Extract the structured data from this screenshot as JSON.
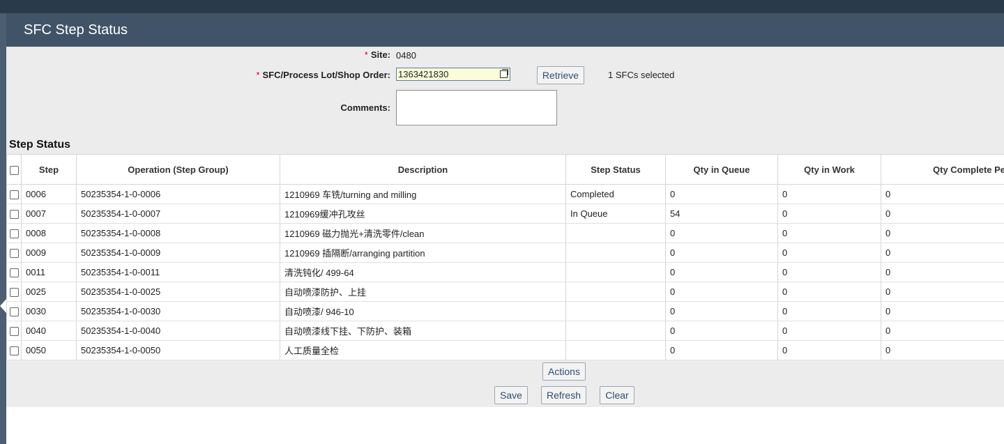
{
  "app": {
    "title": "SFC Step Status"
  },
  "form": {
    "site_label": "Site:",
    "site_value": "0480",
    "sfc_label": "SFC/Process Lot/Shop Order:",
    "sfc_value": "1363421830",
    "retrieve_label": "Retrieve",
    "selected_text": "1 SFCs selected",
    "comments_label": "Comments:",
    "required_mark": "*"
  },
  "step_status": {
    "title": "Step Status",
    "columns": [
      "Step",
      "Operation (Step Group)",
      "Description",
      "Step Status",
      "Qty in Queue",
      "Qty in Work",
      "Qty Complete Pe"
    ],
    "rows": [
      [
        "0006",
        "50235354-1-0-0006",
        "1210969 车铣/turning and milling",
        "Completed",
        "0",
        "0",
        "0"
      ],
      [
        "0007",
        "50235354-1-0-0007",
        "1210969缓冲孔攻丝",
        "In Queue",
        "54",
        "0",
        "0"
      ],
      [
        "0008",
        "50235354-1-0-0008",
        "1210969 磁力抛光+清洗零件/clean",
        "",
        "0",
        "0",
        "0"
      ],
      [
        "0009",
        "50235354-1-0-0009",
        "1210969 插隔断/arranging partition",
        "",
        "0",
        "0",
        "0"
      ],
      [
        "0011",
        "50235354-1-0-0011",
        "清洗钝化/ 499-64",
        "",
        "0",
        "0",
        "0"
      ],
      [
        "0025",
        "50235354-1-0-0025",
        "自动喷漆防护、上挂",
        "",
        "0",
        "0",
        "0"
      ],
      [
        "0030",
        "50235354-1-0-0030",
        "自动喷漆/ 946-10",
        "",
        "0",
        "0",
        "0"
      ],
      [
        "0040",
        "50235354-1-0-0040",
        "自动喷漆线下挂、下防护、装箱",
        "",
        "0",
        "0",
        "0"
      ],
      [
        "0050",
        "50235354-1-0-0050",
        "人工质量全检",
        "",
        "0",
        "0",
        "0"
      ]
    ]
  },
  "actions": {
    "actions_label": "Actions",
    "save_label": "Save",
    "refresh_label": "Refresh",
    "clear_label": "Clear"
  }
}
